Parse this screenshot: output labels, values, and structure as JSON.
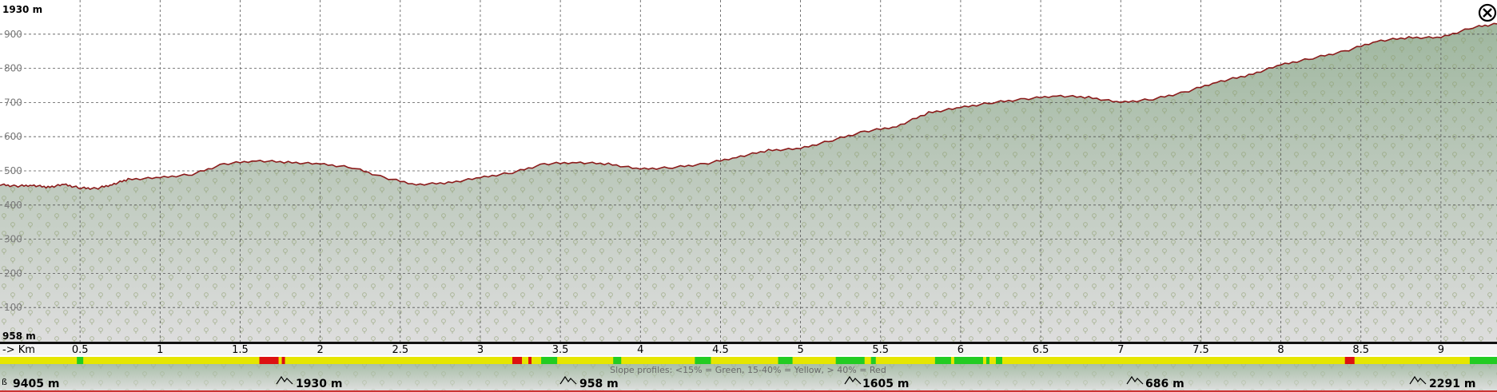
{
  "chart_data": {
    "type": "area",
    "title": "",
    "xlabel": "-> Km",
    "ylabel": "",
    "ylim": [
      0,
      1000
    ],
    "xlim": [
      0,
      9.35
    ],
    "grid": true,
    "y_top_label": "1930 m",
    "y_bottom_label": "958 m",
    "y_ticks": [
      {
        "value": 900,
        "label": "900"
      },
      {
        "value": 800,
        "label": "800"
      },
      {
        "value": 700,
        "label": "700"
      },
      {
        "value": 600,
        "label": "600"
      },
      {
        "value": 500,
        "label": "500"
      },
      {
        "value": 400,
        "label": "400"
      },
      {
        "value": 300,
        "label": "300"
      },
      {
        "value": 200,
        "label": "200"
      },
      {
        "value": 100,
        "label": "100"
      }
    ],
    "x_ticks": [
      {
        "value": 0.5,
        "label": "0.5"
      },
      {
        "value": 1,
        "label": "1"
      },
      {
        "value": 1.5,
        "label": "1.5"
      },
      {
        "value": 2,
        "label": "2"
      },
      {
        "value": 2.5,
        "label": "2.5"
      },
      {
        "value": 3,
        "label": "3"
      },
      {
        "value": 3.5,
        "label": "3.5"
      },
      {
        "value": 4,
        "label": "4"
      },
      {
        "value": 4.5,
        "label": "4.5"
      },
      {
        "value": 5,
        "label": "5"
      },
      {
        "value": 5.5,
        "label": "5.5"
      },
      {
        "value": 6,
        "label": "6"
      },
      {
        "value": 6.5,
        "label": "6.5"
      },
      {
        "value": 7,
        "label": "7"
      },
      {
        "value": 7.5,
        "label": "7.5"
      },
      {
        "value": 8,
        "label": "8"
      },
      {
        "value": 8.5,
        "label": "8.5"
      },
      {
        "value": 9,
        "label": "9"
      }
    ],
    "series": [
      {
        "x": [
          0,
          0.1,
          0.2,
          0.3,
          0.4,
          0.5,
          0.6,
          0.7,
          0.8,
          1.0,
          1.2,
          1.4,
          1.6,
          1.8,
          2.0,
          2.2,
          2.4,
          2.6,
          2.8,
          3.0,
          3.2,
          3.4,
          3.6,
          3.8,
          4.0,
          4.2,
          4.4,
          4.6,
          4.8,
          5.0,
          5.2,
          5.4,
          5.6,
          5.8,
          6.0,
          6.2,
          6.4,
          6.6,
          6.8,
          7.0,
          7.2,
          7.4,
          7.6,
          7.8,
          8.0,
          8.2,
          8.4,
          8.6,
          8.8,
          9.0,
          9.2,
          9.35
        ],
        "y": [
          460,
          455,
          458,
          452,
          460,
          450,
          448,
          460,
          475,
          480,
          490,
          520,
          530,
          525,
          520,
          510,
          480,
          460,
          465,
          480,
          495,
          520,
          525,
          520,
          505,
          510,
          520,
          540,
          560,
          565,
          590,
          615,
          630,
          670,
          685,
          700,
          710,
          720,
          715,
          700,
          710,
          730,
          760,
          780,
          810,
          830,
          850,
          880,
          890,
          890,
          920,
          930
        ]
      }
    ],
    "slope_profile": {
      "legend": "Slope profiles: <15% = Green, 15-40% = Yellow, > 40% = Red",
      "base_color": "#e6e600",
      "colors": {
        "green": "#22cc22",
        "yellow": "#e6e600",
        "red": "#dd1111"
      },
      "segments": [
        {
          "x0": 0.48,
          "x1": 0.52,
          "color": "green"
        },
        {
          "x0": 1.62,
          "x1": 1.74,
          "color": "red"
        },
        {
          "x0": 1.76,
          "x1": 1.78,
          "color": "red"
        },
        {
          "x0": 3.2,
          "x1": 3.26,
          "color": "red"
        },
        {
          "x0": 3.3,
          "x1": 3.32,
          "color": "red"
        },
        {
          "x0": 3.38,
          "x1": 3.48,
          "color": "green"
        },
        {
          "x0": 3.83,
          "x1": 3.88,
          "color": "green"
        },
        {
          "x0": 4.34,
          "x1": 4.44,
          "color": "green"
        },
        {
          "x0": 4.86,
          "x1": 4.95,
          "color": "green"
        },
        {
          "x0": 5.22,
          "x1": 5.4,
          "color": "green"
        },
        {
          "x0": 5.44,
          "x1": 5.47,
          "color": "green"
        },
        {
          "x0": 5.84,
          "x1": 5.94,
          "color": "green"
        },
        {
          "x0": 5.96,
          "x1": 6.14,
          "color": "green"
        },
        {
          "x0": 6.16,
          "x1": 6.18,
          "color": "green"
        },
        {
          "x0": 6.22,
          "x1": 6.26,
          "color": "green"
        },
        {
          "x0": 8.4,
          "x1": 8.46,
          "color": "red"
        },
        {
          "x0": 9.18,
          "x1": 9.35,
          "color": "green"
        }
      ]
    },
    "colors": {
      "profile_line": "#8b1a1a",
      "fill_top": "#9fb79f",
      "fill_bottom": "#dddddd",
      "grid": "#555555"
    }
  },
  "stats": {
    "distance": "9405 m",
    "max_elevation": "1930 m",
    "min_elevation": "958 m",
    "total_ascent": "1605 m",
    "total_descent": "686 m",
    "max_range": "2291 m"
  },
  "close_icon_name": "close-icon"
}
